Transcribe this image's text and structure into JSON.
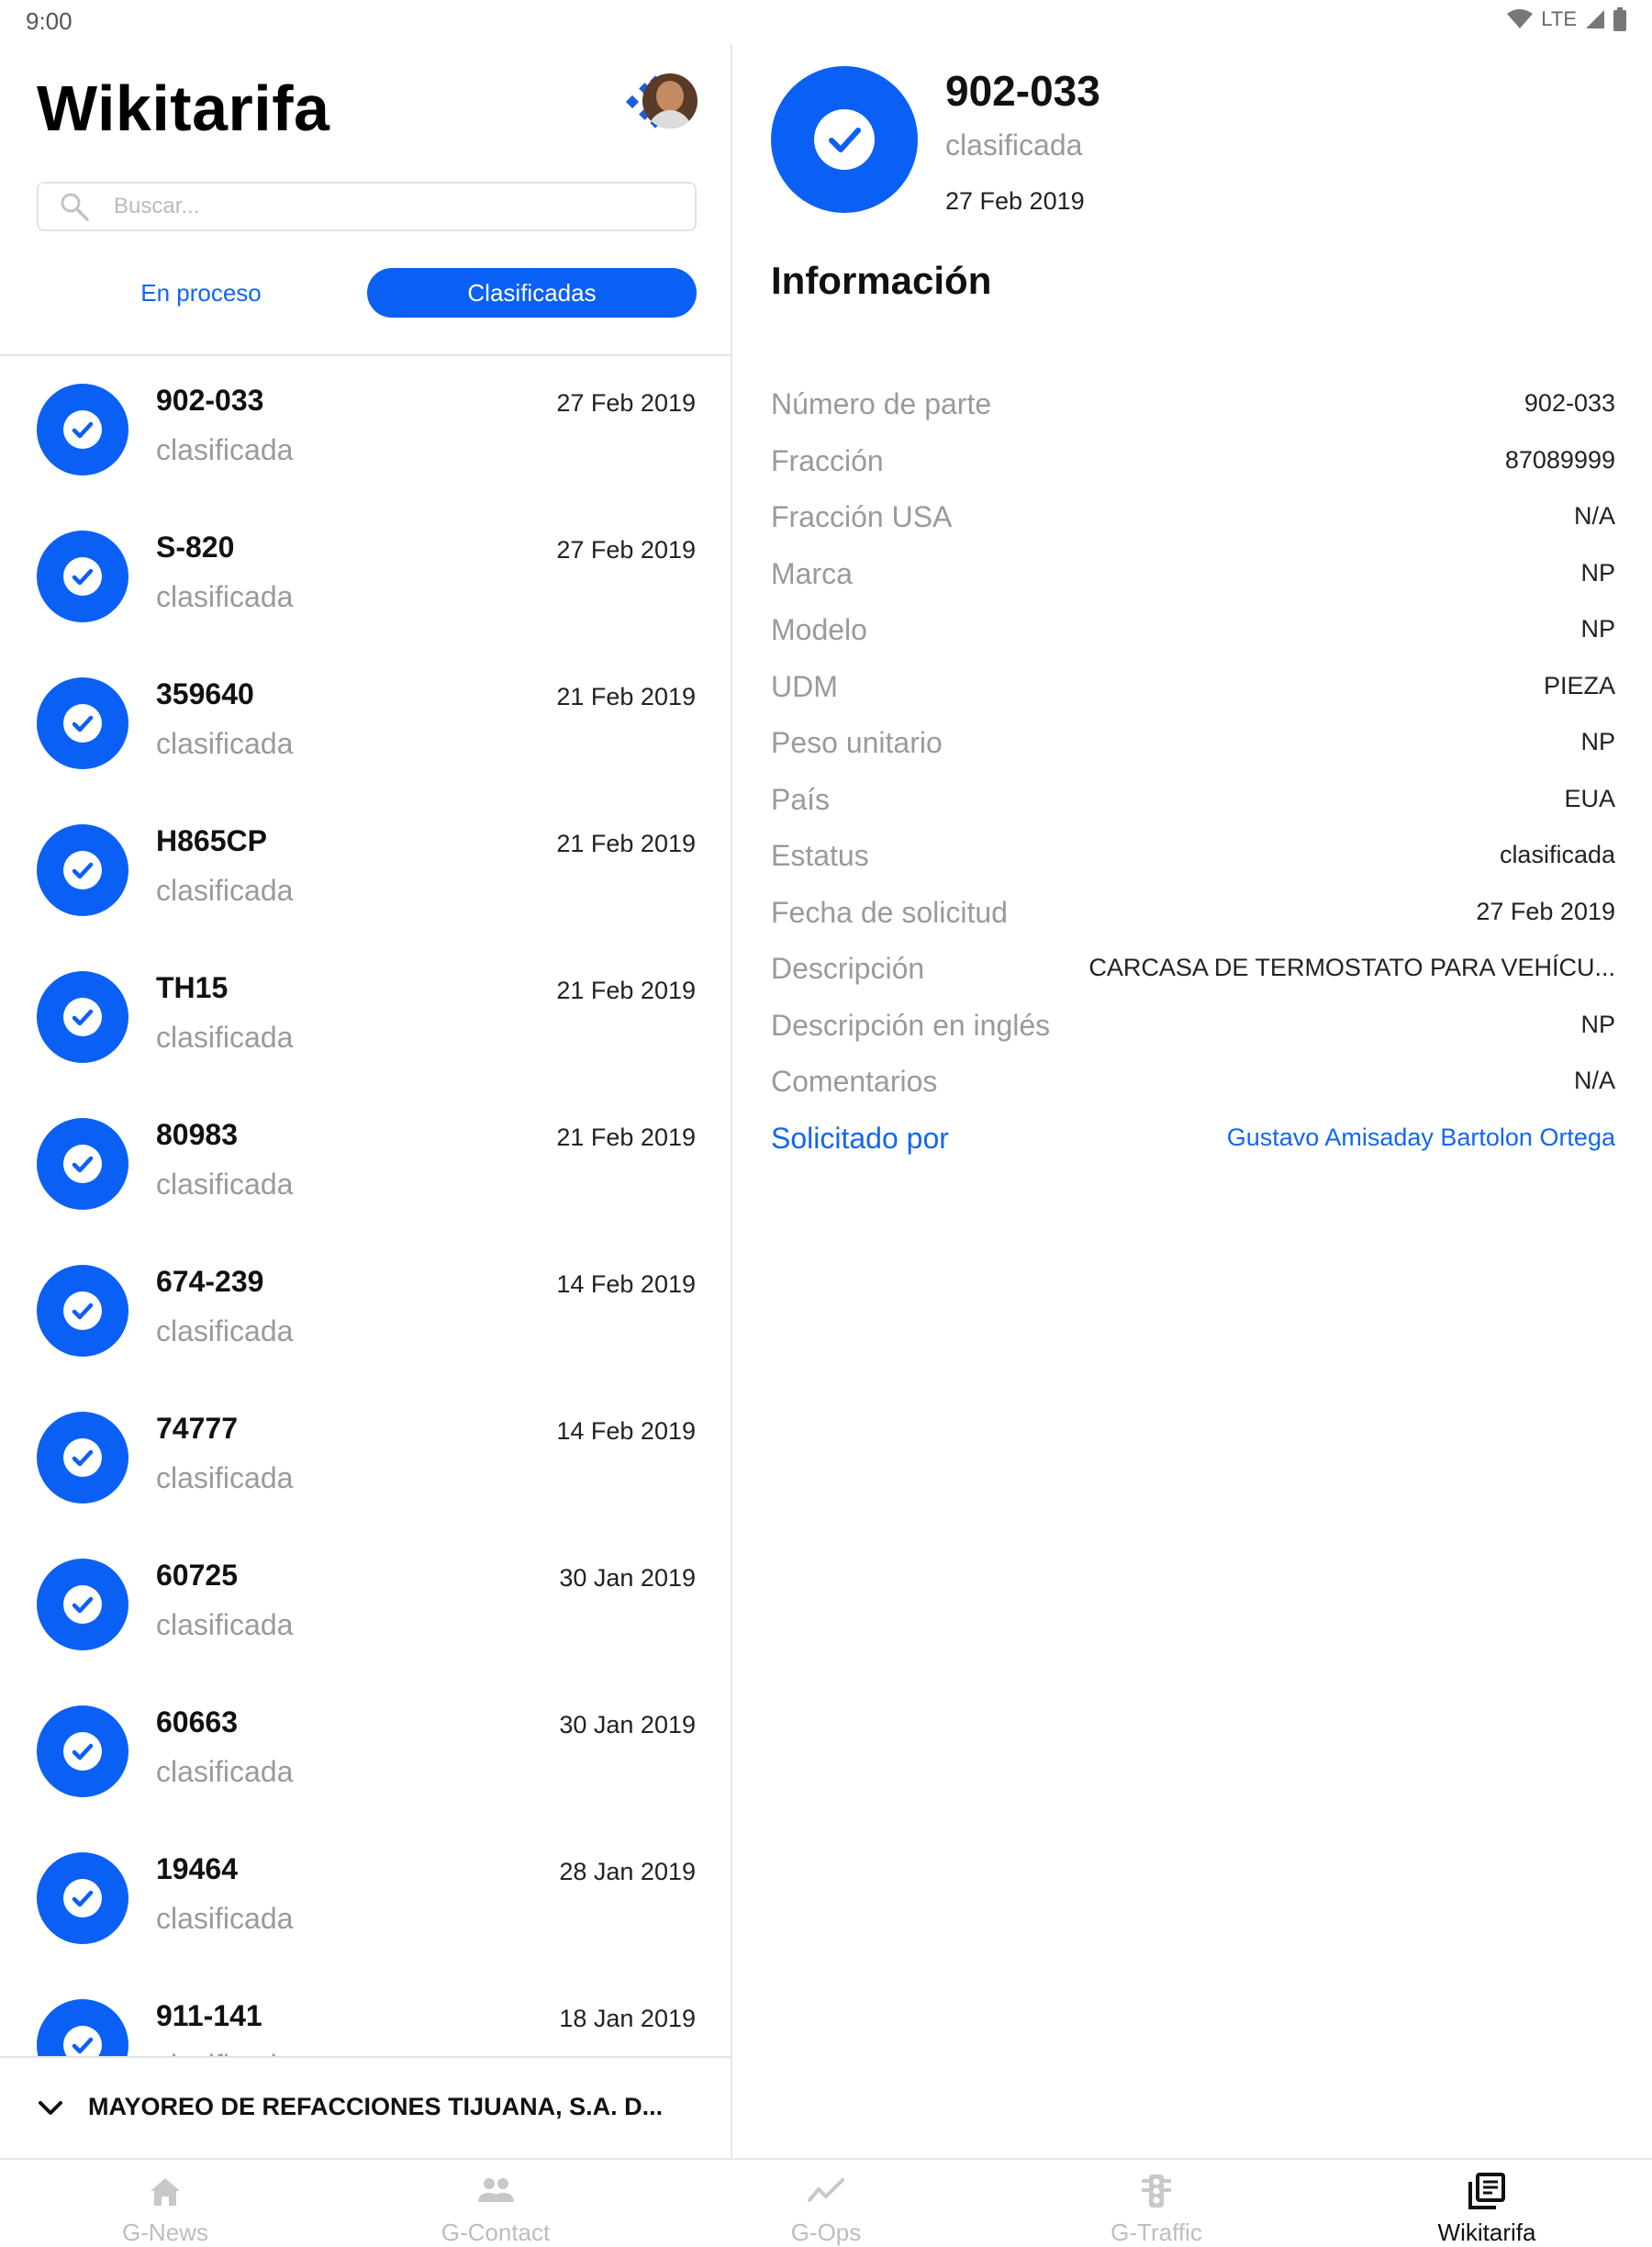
{
  "status_bar": {
    "time": "9:00",
    "network": "LTE"
  },
  "app": {
    "title": "Wikitarifa"
  },
  "search": {
    "placeholder": "Buscar..."
  },
  "segments": {
    "in_process": "En proceso",
    "classified": "Clasificadas"
  },
  "list": {
    "items": [
      {
        "title": "902-033",
        "status": "clasificada",
        "date": "27 Feb 2019"
      },
      {
        "title": "S-820",
        "status": "clasificada",
        "date": "27 Feb 2019"
      },
      {
        "title": "359640",
        "status": "clasificada",
        "date": "21 Feb 2019"
      },
      {
        "title": "H865CP",
        "status": "clasificada",
        "date": "21 Feb 2019"
      },
      {
        "title": "TH15",
        "status": "clasificada",
        "date": "21 Feb 2019"
      },
      {
        "title": "80983",
        "status": "clasificada",
        "date": "21 Feb 2019"
      },
      {
        "title": "674-239",
        "status": "clasificada",
        "date": "14 Feb 2019"
      },
      {
        "title": "74777",
        "status": "clasificada",
        "date": "14 Feb 2019"
      },
      {
        "title": "60725",
        "status": "clasificada",
        "date": "30 Jan 2019"
      },
      {
        "title": "60663",
        "status": "clasificada",
        "date": "30 Jan 2019"
      },
      {
        "title": "19464",
        "status": "clasificada",
        "date": "28 Jan 2019"
      },
      {
        "title": "911-141",
        "status": "clasificada",
        "date": "18 Jan 2019"
      }
    ]
  },
  "company": {
    "name": "MAYOREO DE REFACCIONES TIJUANA, S.A. D..."
  },
  "detail": {
    "title": "902-033",
    "status": "clasificada",
    "date": "27 Feb 2019",
    "info_heading": "Información",
    "rows": [
      {
        "label": "Número de parte",
        "value": "902-033"
      },
      {
        "label": "Fracción",
        "value": "87089999"
      },
      {
        "label": "Fracción USA",
        "value": "N/A"
      },
      {
        "label": "Marca",
        "value": "NP"
      },
      {
        "label": "Modelo",
        "value": "NP"
      },
      {
        "label": "UDM",
        "value": "PIEZA"
      },
      {
        "label": "Peso unitario",
        "value": "NP"
      },
      {
        "label": "País",
        "value": "EUA"
      },
      {
        "label": "Estatus",
        "value": "clasificada"
      },
      {
        "label": "Fecha de solicitud",
        "value": "27 Feb 2019"
      },
      {
        "label": "Descripción",
        "value": "CARCASA DE TERMOSTATO PARA VEHÍCU..."
      },
      {
        "label": "Descripción en inglés",
        "value": "NP"
      },
      {
        "label": "Comentarios",
        "value": "N/A"
      },
      {
        "label": "Solicitado por",
        "value": "Gustavo Amisaday Bartolon Ortega"
      }
    ]
  },
  "bottom_nav": {
    "items": [
      {
        "label": "G-News",
        "icon": "home-icon"
      },
      {
        "label": "G-Contact",
        "icon": "people-icon"
      },
      {
        "label": "G-Ops",
        "icon": "trend-icon"
      },
      {
        "label": "G-Traffic",
        "icon": "traffic-light-icon"
      },
      {
        "label": "Wikitarifa",
        "icon": "library-books-icon"
      }
    ],
    "active": "Wikitarifa"
  },
  "colors": {
    "accent": "#0A60F5",
    "link": "#1266F1",
    "muted_text": "#9A9A9A",
    "inactive_nav": "#BDBDBD"
  }
}
